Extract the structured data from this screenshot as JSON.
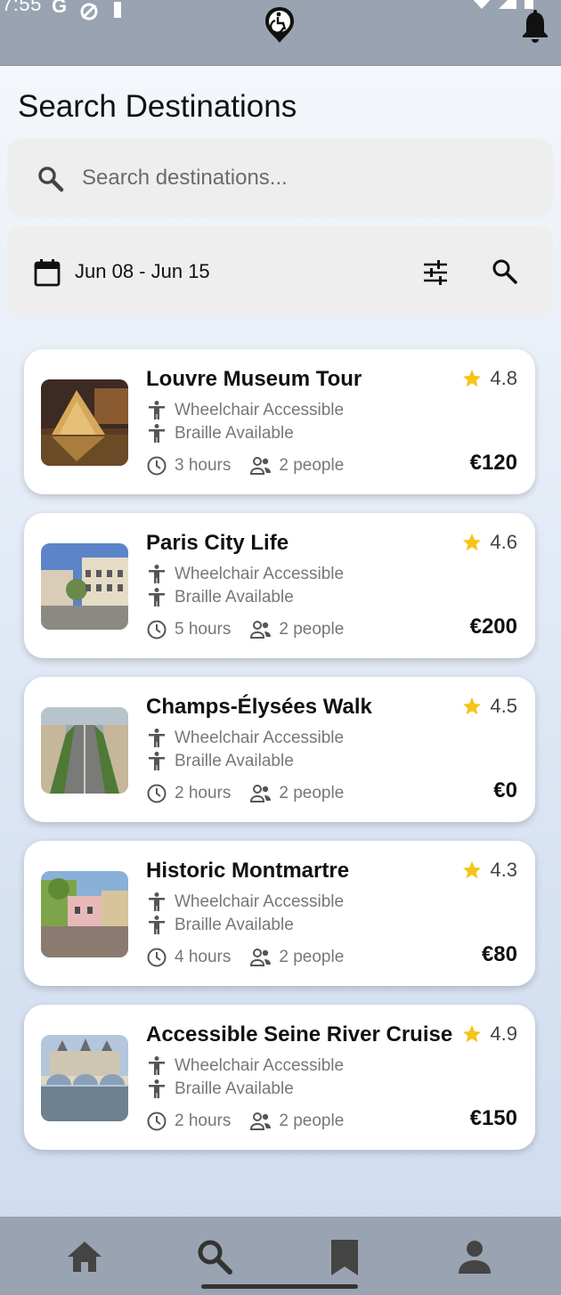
{
  "status_bar": {
    "time": "7:55",
    "left_icons": [
      "G"
    ]
  },
  "colors": {
    "topbar": "#9aa3b1",
    "star": "#f5c518",
    "text": "#111111",
    "muted": "#777777"
  },
  "page": {
    "title": "Search Destinations"
  },
  "search": {
    "placeholder": "Search destinations..."
  },
  "filters": {
    "date_range": "Jun 08 - Jun 15"
  },
  "destinations": [
    {
      "title": "Louvre Museum Tour",
      "rating": "4.8",
      "features": [
        "Wheelchair Accessible",
        "Braille Available"
      ],
      "duration": "3 hours",
      "people": "2 people",
      "price": "€120"
    },
    {
      "title": "Paris City Life",
      "rating": "4.6",
      "features": [
        "Wheelchair Accessible",
        "Braille Available"
      ],
      "duration": "5 hours",
      "people": "2 people",
      "price": "€200"
    },
    {
      "title": "Champs-Élysées Walk",
      "rating": "4.5",
      "features": [
        "Wheelchair Accessible",
        "Braille Available"
      ],
      "duration": "2 hours",
      "people": "2 people",
      "price": "€0"
    },
    {
      "title": "Historic Montmartre",
      "rating": "4.3",
      "features": [
        "Wheelchair Accessible",
        "Braille Available"
      ],
      "duration": "4 hours",
      "people": "2 people",
      "price": "€80"
    },
    {
      "title": "Accessible Seine River Cruise",
      "rating": "4.9",
      "features": [
        "Wheelchair Accessible",
        "Braille Available"
      ],
      "duration": "2 hours",
      "people": "2 people",
      "price": "€150"
    }
  ],
  "bottom_nav": {
    "items": [
      "home-icon",
      "search-icon",
      "bookmark-icon",
      "profile-icon"
    ],
    "active": "search-icon"
  }
}
